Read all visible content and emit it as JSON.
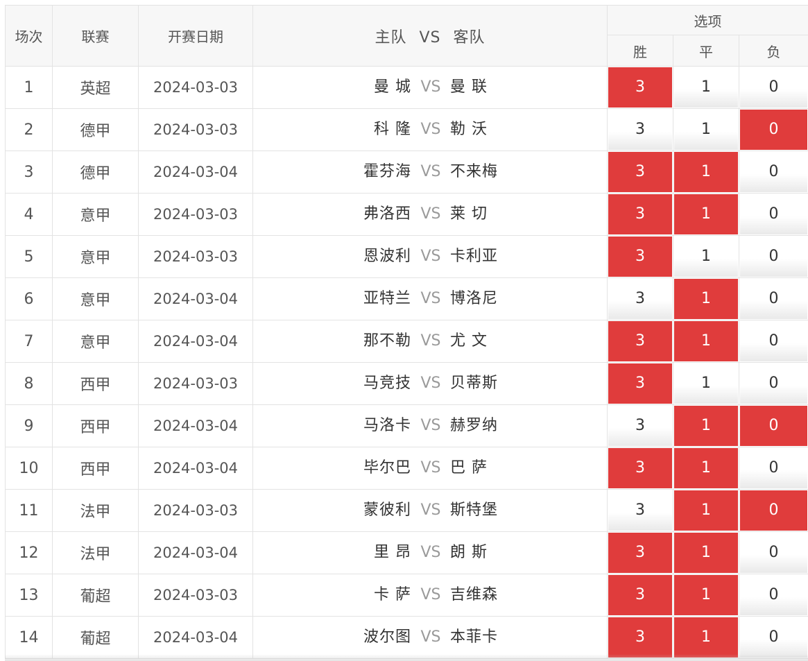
{
  "header": {
    "col_index": "场次",
    "col_league": "联赛",
    "col_date": "开赛日期",
    "col_home": "主队",
    "col_vs": "VS",
    "col_away": "客队",
    "options_group": "选项",
    "opt_win": "胜",
    "opt_draw": "平",
    "opt_lose": "负"
  },
  "colors": {
    "selected": "#e03c3c",
    "vs_text": "#9a9a9a",
    "border": "#e3e3e3"
  },
  "matches": [
    {
      "index": "1",
      "league": "英超",
      "date": "2024-03-03",
      "home": "曼 城",
      "vs": "VS",
      "away": "曼 联",
      "win": "3",
      "draw": "1",
      "lose": "0",
      "win_sel": true,
      "draw_sel": false,
      "lose_sel": false
    },
    {
      "index": "2",
      "league": "德甲",
      "date": "2024-03-03",
      "home": "科 隆",
      "vs": "VS",
      "away": "勒 沃",
      "win": "3",
      "draw": "1",
      "lose": "0",
      "win_sel": false,
      "draw_sel": false,
      "lose_sel": true
    },
    {
      "index": "3",
      "league": "德甲",
      "date": "2024-03-04",
      "home": "霍芬海",
      "vs": "VS",
      "away": "不来梅",
      "win": "3",
      "draw": "1",
      "lose": "0",
      "win_sel": true,
      "draw_sel": true,
      "lose_sel": false
    },
    {
      "index": "4",
      "league": "意甲",
      "date": "2024-03-03",
      "home": "弗洛西",
      "vs": "VS",
      "away": "莱 切",
      "win": "3",
      "draw": "1",
      "lose": "0",
      "win_sel": true,
      "draw_sel": true,
      "lose_sel": false
    },
    {
      "index": "5",
      "league": "意甲",
      "date": "2024-03-03",
      "home": "恩波利",
      "vs": "VS",
      "away": "卡利亚",
      "win": "3",
      "draw": "1",
      "lose": "0",
      "win_sel": true,
      "draw_sel": false,
      "lose_sel": false
    },
    {
      "index": "6",
      "league": "意甲",
      "date": "2024-03-04",
      "home": "亚特兰",
      "vs": "VS",
      "away": "博洛尼",
      "win": "3",
      "draw": "1",
      "lose": "0",
      "win_sel": false,
      "draw_sel": true,
      "lose_sel": false
    },
    {
      "index": "7",
      "league": "意甲",
      "date": "2024-03-04",
      "home": "那不勒",
      "vs": "VS",
      "away": "尤 文",
      "win": "3",
      "draw": "1",
      "lose": "0",
      "win_sel": true,
      "draw_sel": true,
      "lose_sel": false
    },
    {
      "index": "8",
      "league": "西甲",
      "date": "2024-03-03",
      "home": "马竞技",
      "vs": "VS",
      "away": "贝蒂斯",
      "win": "3",
      "draw": "1",
      "lose": "0",
      "win_sel": true,
      "draw_sel": false,
      "lose_sel": false
    },
    {
      "index": "9",
      "league": "西甲",
      "date": "2024-03-04",
      "home": "马洛卡",
      "vs": "VS",
      "away": "赫罗纳",
      "win": "3",
      "draw": "1",
      "lose": "0",
      "win_sel": false,
      "draw_sel": true,
      "lose_sel": true
    },
    {
      "index": "10",
      "league": "西甲",
      "date": "2024-03-04",
      "home": "毕尔巴",
      "vs": "VS",
      "away": "巴 萨",
      "win": "3",
      "draw": "1",
      "lose": "0",
      "win_sel": true,
      "draw_sel": true,
      "lose_sel": false
    },
    {
      "index": "11",
      "league": "法甲",
      "date": "2024-03-03",
      "home": "蒙彼利",
      "vs": "VS",
      "away": "斯特堡",
      "win": "3",
      "draw": "1",
      "lose": "0",
      "win_sel": false,
      "draw_sel": true,
      "lose_sel": true
    },
    {
      "index": "12",
      "league": "法甲",
      "date": "2024-03-04",
      "home": "里 昂",
      "vs": "VS",
      "away": "朗 斯",
      "win": "3",
      "draw": "1",
      "lose": "0",
      "win_sel": true,
      "draw_sel": true,
      "lose_sel": false
    },
    {
      "index": "13",
      "league": "葡超",
      "date": "2024-03-03",
      "home": "卡 萨",
      "vs": "VS",
      "away": "吉维森",
      "win": "3",
      "draw": "1",
      "lose": "0",
      "win_sel": true,
      "draw_sel": true,
      "lose_sel": false
    },
    {
      "index": "14",
      "league": "葡超",
      "date": "2024-03-04",
      "home": "波尔图",
      "vs": "VS",
      "away": "本菲卡",
      "win": "3",
      "draw": "1",
      "lose": "0",
      "win_sel": true,
      "draw_sel": true,
      "lose_sel": false
    }
  ]
}
